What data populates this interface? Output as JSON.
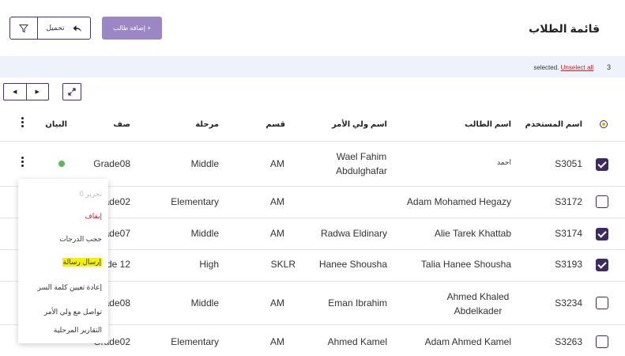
{
  "header": {
    "title": "قائمة الطلاب",
    "add_button": "+ إضافة طالب",
    "load_button": "تحميل"
  },
  "selection": {
    "count": "3",
    "text": "selected.",
    "unselect": "Unselect all"
  },
  "columns": {
    "username": "اسم المستخدم",
    "student": "اسم الطالب",
    "guardian": "اسم ولي الأمر",
    "section": "قسم",
    "stage": "مرحلة",
    "grade": "صف",
    "status": "البيان"
  },
  "rows": [
    {
      "username": "S3051",
      "student": "احمد",
      "guardian": "Wael Fahim Abdulghafar",
      "section": "AM",
      "stage": "Middle",
      "grade": "Grade08",
      "checked": true
    },
    {
      "username": "S3172",
      "student": "Adam Mohamed Hegazy",
      "guardian": "",
      "section": "AM",
      "stage": "Elementary",
      "grade": "Grade02",
      "checked": false
    },
    {
      "username": "S3174",
      "student": "Alie Tarek Khattab",
      "guardian": "Radwa Eldinary",
      "section": "AM",
      "stage": "Middle",
      "grade": "Grade07",
      "checked": true
    },
    {
      "username": "S3193",
      "student": "Talia Hanee Shousha",
      "guardian": "Hanee Shousha",
      "section": "SKLR",
      "stage": "High",
      "grade": "Grade 12",
      "checked": true
    },
    {
      "username": "S3234",
      "student": "Ahmed Khaled Abdelkader",
      "guardian": "Eman Ibrahim",
      "section": "AM",
      "stage": "Middle",
      "grade": "Grade08",
      "checked": false
    },
    {
      "username": "S3263",
      "student": "Adam Ahmed Kamel",
      "guardian": "Ahmed Kamel",
      "section": "AM",
      "stage": "Elementary",
      "grade": "Grade02",
      "checked": false
    }
  ],
  "row_visible_grade": [
    "Grade08",
    "ade02",
    "ade07",
    "de 12",
    "ade08",
    "Grade02"
  ],
  "menu": {
    "edit": "تحرير 0",
    "stop": "إيقاف",
    "block_grades": "حجب الدرجات",
    "send_message": "إرسال رسالة",
    "reset_password": "إعادة تعيين كلمة السر",
    "contact_guardian": "تواصل مع ولي الأمر",
    "stage_reports": "التقارير المرحلية"
  },
  "colors": {
    "primary": "#3d2a63",
    "add_button": "#9b87c4",
    "selection_bg": "#eef3fb",
    "status_active": "#5cb85c",
    "highlight": "#f6f100",
    "danger": "#cc1f1f"
  }
}
